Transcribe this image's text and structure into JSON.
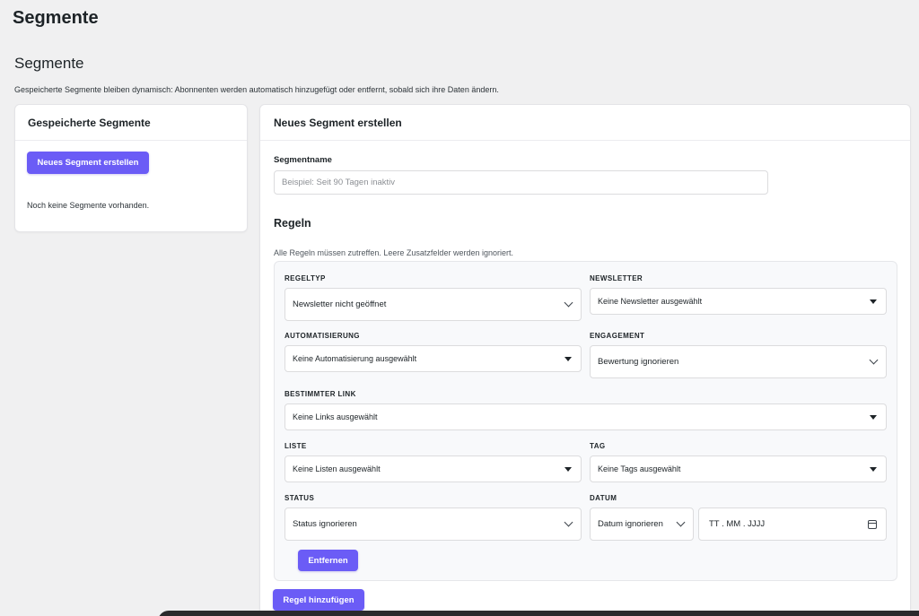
{
  "page": {
    "title": "Segmente"
  },
  "section": {
    "title": "Segmente",
    "description": "Gespeicherte Segmente bleiben dynamisch: Abonnenten werden automatisch hinzugefügt oder entfernt, sobald sich ihre Daten ändern."
  },
  "saved": {
    "title": "Gespeicherte Segmente",
    "new_button": "Neues Segment erstellen",
    "empty_text": "Noch keine Segmente vorhanden."
  },
  "create": {
    "title": "Neues Segment erstellen",
    "name_label": "Segmentname",
    "name_placeholder": "Beispiel: Seit 90 Tagen inaktiv",
    "name_value": "",
    "rules_title": "Regeln",
    "rules_description": "Alle Regeln müssen zutreffen. Leere Zusatzfelder werden ignoriert.",
    "rule": {
      "type_label": "REGELTYP",
      "type_value": "Newsletter nicht geöffnet",
      "newsletter_label": "NEWSLETTER",
      "newsletter_value": "Keine Newsletter ausgewählt",
      "automation_label": "AUTOMATISIERUNG",
      "automation_value": "Keine Automatisierung ausgewählt",
      "engagement_label": "ENGAGEMENT",
      "engagement_value": "Bewertung ignorieren",
      "link_label": "BESTIMMTER LINK",
      "link_value": "Keine Links ausgewählt",
      "list_label": "LISTE",
      "list_value": "Keine Listen ausgewählt",
      "tag_label": "TAG",
      "tag_value": "Keine Tags ausgewählt",
      "status_label": "STATUS",
      "status_value": "Status ignorieren",
      "date_label": "DATUM",
      "date_mode_value": "Datum ignorieren",
      "date_input_value": "TT . MM . JJJJ",
      "remove_button": "Entfernen"
    },
    "add_rule_button": "Regel hinzufügen"
  },
  "colors": {
    "accent": "#6b5cf6",
    "background": "#f0f0f1",
    "card": "#ffffff"
  },
  "icons": {
    "chevron": "chevron-down-icon",
    "caret": "caret-down-icon",
    "calendar": "calendar-icon"
  }
}
